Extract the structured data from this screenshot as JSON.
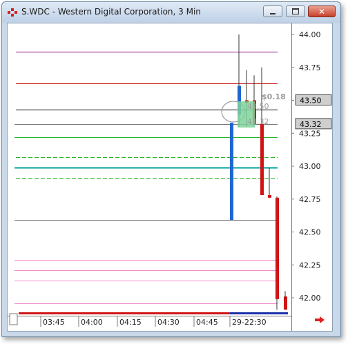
{
  "window": {
    "title": "S.WDC - Western Digital Corporation, 3 Min",
    "controls": [
      "minimize",
      "maximize",
      "close"
    ]
  },
  "chart_data": {
    "type": "candlestick",
    "symbol": "S.WDC",
    "interval": "3 Min",
    "ylim": [
      41.88,
      44.07
    ],
    "y_ticks": [
      "44.00",
      "43.75",
      "43.50",
      "43.25",
      "43.00",
      "42.75",
      "42.50",
      "42.25",
      "42.00"
    ],
    "x_ticks": [
      "03:45",
      "04:00",
      "04:15",
      "04:30",
      "04:45",
      "29-22:30"
    ],
    "price_markers": [
      {
        "label": "43.50",
        "value": 43.5
      },
      {
        "label": "43.32",
        "value": 43.32
      }
    ],
    "annotations": {
      "pl": "$0.18",
      "entry": "43.50",
      "exit": "43.32"
    },
    "horizontal_lines": [
      {
        "value": 43.87,
        "color": "#800080",
        "style": "solid"
      },
      {
        "value": 43.63,
        "color": "#c00000",
        "style": "solid"
      },
      {
        "value": 43.43,
        "color": "#000000",
        "style": "solid"
      },
      {
        "value": 43.32,
        "color": "#7a7a7a",
        "style": "solid"
      },
      {
        "value": 43.22,
        "color": "#22b822",
        "style": "solid"
      },
      {
        "value": 43.07,
        "color": "#22b822",
        "style": "dashed"
      },
      {
        "value": 42.99,
        "color": "#00a0a0",
        "style": "solid"
      },
      {
        "value": 42.91,
        "color": "#22b822",
        "style": "dashed"
      },
      {
        "value": 42.59,
        "color": "#7a7a7a",
        "style": "solid"
      },
      {
        "value": 42.29,
        "color": "#f48ad0",
        "style": "solid"
      },
      {
        "value": 42.21,
        "color": "#f48ad0",
        "style": "solid"
      },
      {
        "value": 42.13,
        "color": "#f48ad0",
        "style": "solid"
      },
      {
        "value": 41.96,
        "color": "#f48ad0",
        "style": "solid"
      }
    ],
    "candles": [
      {
        "o": 42.59,
        "h": 43.33,
        "l": 42.59,
        "c": 43.33,
        "dir": "up"
      },
      {
        "o": 43.39,
        "h": 44.0,
        "l": 43.3,
        "c": 43.61,
        "dir": "up"
      },
      {
        "o": 43.48,
        "h": 43.73,
        "l": 43.3,
        "c": 43.5,
        "dir": "down"
      },
      {
        "o": 43.5,
        "h": 43.69,
        "l": 43.3,
        "c": 43.32,
        "dir": "down"
      },
      {
        "o": 43.32,
        "h": 43.75,
        "l": 42.78,
        "c": 42.78,
        "dir": "down"
      },
      {
        "o": 42.78,
        "h": 42.99,
        "l": 42.76,
        "c": 42.76,
        "dir": "down"
      },
      {
        "o": 42.76,
        "h": 42.77,
        "l": 41.91,
        "c": 41.99,
        "dir": "down"
      },
      {
        "o": 42.01,
        "h": 42.04,
        "l": 41.91,
        "c": 41.96,
        "dir": "down"
      },
      {
        "o": 41.99,
        "h": 42.05,
        "l": 41.91,
        "c": 41.91,
        "dir": "down"
      }
    ],
    "colors": {
      "up": "#1f66d1",
      "down": "#d01414",
      "entry_box": "#7fd49a"
    }
  }
}
